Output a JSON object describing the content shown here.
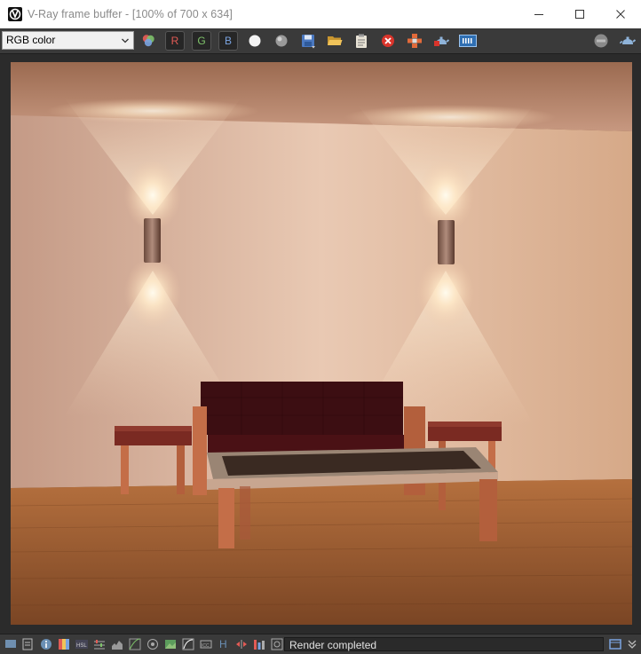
{
  "window": {
    "title": "V-Ray frame buffer - [100% of 700 x 634]"
  },
  "toolbar": {
    "channel_select_value": "RGB color",
    "r_label": "R",
    "g_label": "G",
    "b_label": "B"
  },
  "status": {
    "message": "Render completed",
    "h_label": "H"
  },
  "colors": {
    "window_bg": "#2b2b2b",
    "toolbar_bg": "#3a3a3a",
    "red_channel": "#e25b55",
    "green_channel": "#7ec26a",
    "blue_channel": "#7aa3e0",
    "stop_button": "#d9342b"
  },
  "icons": [
    "vray-logo-icon",
    "minimize-icon",
    "maximize-icon",
    "close-icon",
    "color-channels-icon",
    "white-dot-icon",
    "gray-dot-icon",
    "save-icon",
    "open-folder-icon",
    "clipboard-icon",
    "clear-icon",
    "region-render-icon",
    "render-icon",
    "pixel-info-icon",
    "stop-icon",
    "teapot-icon"
  ]
}
